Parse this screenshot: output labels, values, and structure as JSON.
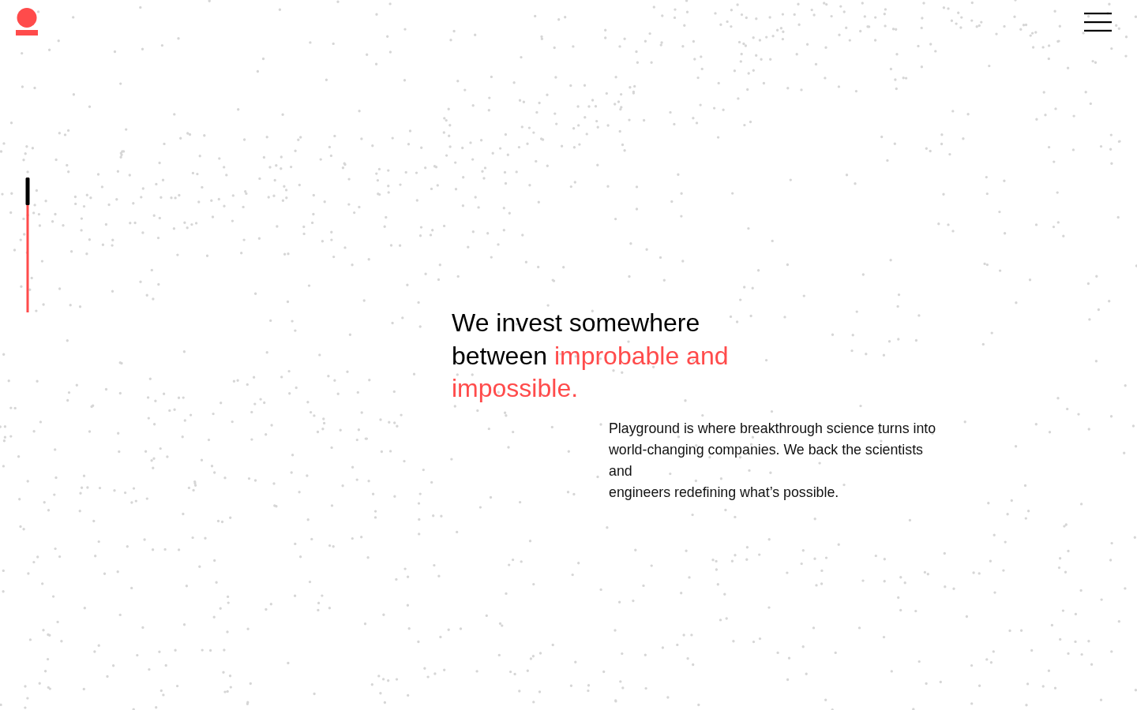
{
  "hero": {
    "headline": [
      {
        "text": "We invest somewhere between ",
        "accent": false
      },
      {
        "text": "improbable and impossible.",
        "accent": true
      }
    ],
    "body": "Playground is where breakthrough science turns into world-changing companies. We back the scientists and\nengineers redefining what’s possible."
  }
}
